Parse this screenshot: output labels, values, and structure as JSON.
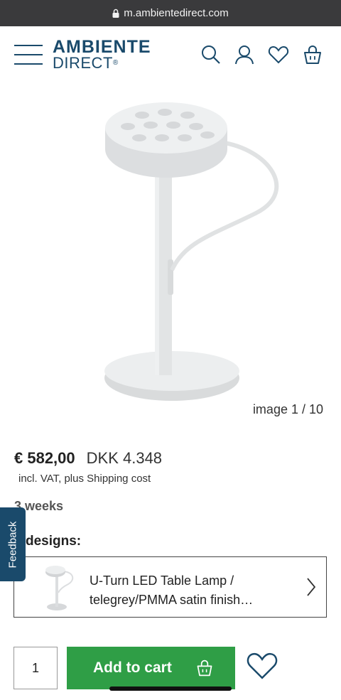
{
  "browser": {
    "url": "m.ambientedirect.com",
    "lock_icon": "lock-icon"
  },
  "header": {
    "logo_line1": "AMBIENTE",
    "logo_line2": "DIRECT",
    "logo_mark": "®",
    "icons": [
      "menu-icon",
      "search-icon",
      "user-icon",
      "heart-icon",
      "basket-icon"
    ]
  },
  "gallery": {
    "counter": "image 1 / 10"
  },
  "product": {
    "price_eur": "€ 582,00",
    "price_dkk": "DKK 4.348",
    "vat_note": "incl. VAT, plus Shipping cost",
    "delivery": "3 weeks",
    "designs_label": "designs:",
    "variant_line1": "U-Turn LED Table Lamp /",
    "variant_line2": "telegrey/PMMA satin finish…"
  },
  "feedback": {
    "label": "Feedback"
  },
  "purchase": {
    "quantity": "1",
    "add_to_cart": "Add to cart"
  },
  "colors": {
    "brand": "#1a4a6b",
    "cart": "#2f9e46",
    "lamp": "#e2e4e5"
  }
}
